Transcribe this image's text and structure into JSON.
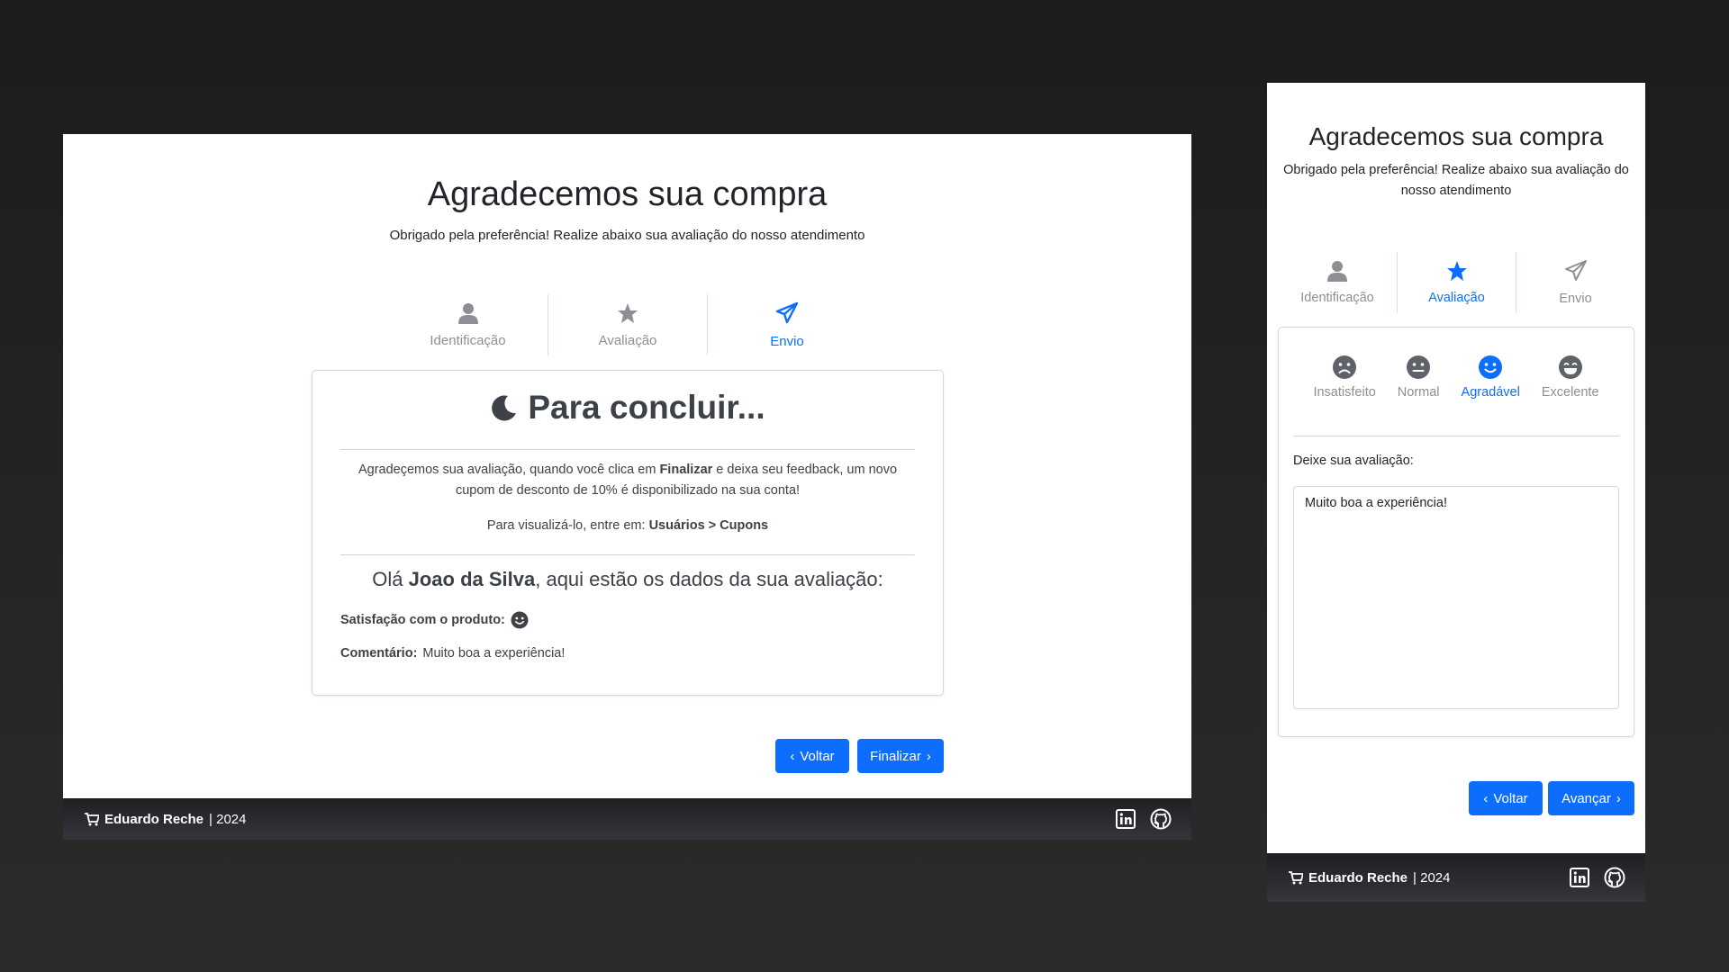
{
  "desktop": {
    "title": "Agradecemos sua compra",
    "subtitle": "Obrigado pela preferência! Realize abaixo sua avaliação do nosso atendimento",
    "steps": [
      {
        "label": "Identificação",
        "icon": "user-icon",
        "active": false
      },
      {
        "label": "Avaliação",
        "icon": "star-icon",
        "active": false
      },
      {
        "label": "Envio",
        "icon": "send-icon",
        "active": true
      }
    ],
    "card": {
      "title": "Para concluir...",
      "text1_pre": "Agradeçemos sua avaliação, quando você clica em ",
      "text1_bold": "Finalizar",
      "text1_post": " e deixa seu feedback, um novo cupom de desconto de 10% é disponibilizado na sua conta!",
      "text2_pre": "Para visualizá-lo, entre em: ",
      "text2_bold": "Usuários > Cupons",
      "hello_pre": "Olá ",
      "hello_name": "Joao da Silva",
      "hello_post": ", aqui estão os dados da sua avaliação:",
      "satisfaction_label": "Satisfação com o produto:",
      "satisfaction_icon": "smile-icon",
      "comment_label": "Comentário:",
      "comment_value": "Muito boa a experiência!"
    },
    "buttons": {
      "back": "Voltar",
      "next": "Finalizar"
    },
    "footer": {
      "brand": "Eduardo Reche",
      "year": "| 2024"
    }
  },
  "mobile": {
    "title": "Agradecemos sua compra",
    "subtitle": "Obrigado pela preferência! Realize abaixo sua avaliação do nosso atendimento",
    "steps": [
      {
        "label": "Identificação",
        "icon": "user-icon",
        "active": false
      },
      {
        "label": "Avaliação",
        "icon": "star-icon",
        "active": true
      },
      {
        "label": "Envio",
        "icon": "send-icon",
        "active": false
      }
    ],
    "ratings": [
      {
        "label": "Insatisfeito",
        "icon": "frown-icon",
        "active": false
      },
      {
        "label": "Normal",
        "icon": "neutral-icon",
        "active": false
      },
      {
        "label": "Agradável",
        "icon": "smile-icon",
        "active": true
      },
      {
        "label": "Excelente",
        "icon": "grin-icon",
        "active": false
      }
    ],
    "review_label": "Deixe sua avaliação:",
    "review_value": "Muito boa a experiência!",
    "buttons": {
      "back": "Voltar",
      "next": "Avançar"
    },
    "footer": {
      "brand": "Eduardo Reche",
      "year": "| 2024"
    }
  },
  "colors": {
    "accent": "#0d6efd",
    "muted": "#8c8f94",
    "footer": "#2a2b2f"
  }
}
